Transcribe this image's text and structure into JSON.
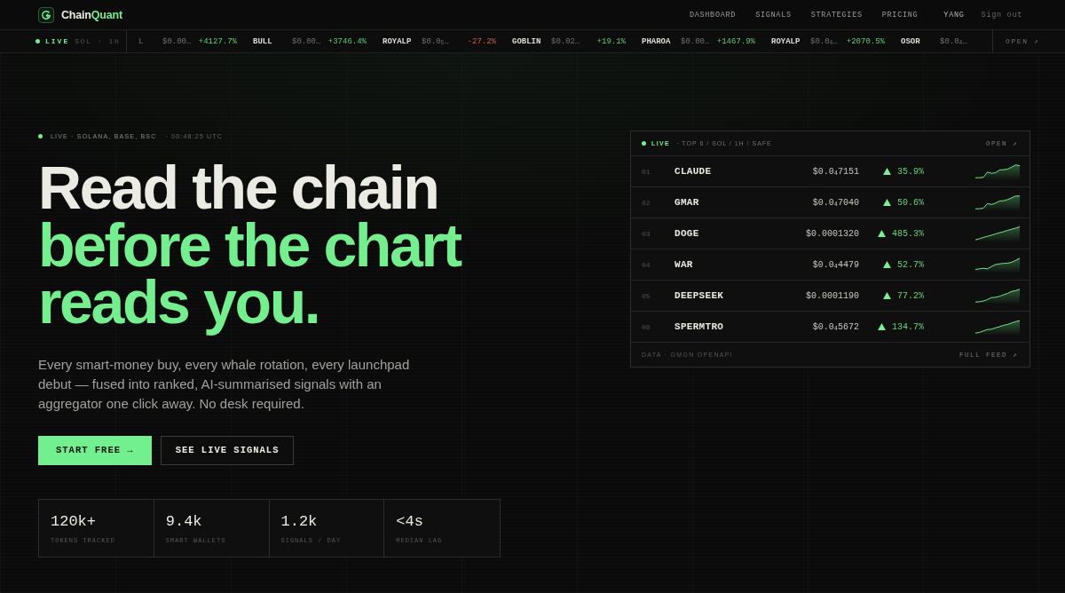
{
  "nav": {
    "brand": [
      "Chain",
      "Quant"
    ],
    "links": [
      "DASHBOARD",
      "SIGNALS",
      "STRATEGIES",
      "PRICING"
    ],
    "user": "YANG",
    "sign_out": "Sign out"
  },
  "ticker": {
    "status": "LIVE",
    "scope": "SOL · 1H",
    "items": [
      {
        "symbol": "L",
        "price": "$0.00…",
        "change": "+4127.7%",
        "down": false
      },
      {
        "symbol": "BULL",
        "price": "$0.00…",
        "change": "+3746.4%",
        "down": false
      },
      {
        "symbol": "ROYALP",
        "price": "$0.0$_{5}$…",
        "change": "-27.2%",
        "down": true
      },
      {
        "symbol": "GOBLIN",
        "price": "$0.02…",
        "change": "+19.1%",
        "down": false
      },
      {
        "symbol": "PHAROA",
        "price": "$0.00…",
        "change": "+1467.9%",
        "down": false
      },
      {
        "symbol": "ROYALP",
        "price": "$0.0$_{4}$…",
        "change": "+2070.5%",
        "down": false
      },
      {
        "symbol": "OSOR",
        "price": "$0.0$_{4}$…"
      }
    ],
    "action": "OPEN ↗"
  },
  "hero": {
    "status": {
      "label": "LIVE · SOLANA, BASE, BSC",
      "time": "· 00:48:25 UTC"
    },
    "headline": [
      {
        "text": "Read the chain",
        "accent": false
      },
      {
        "text": "before the chart",
        "accent": true
      },
      {
        "text": "reads you.",
        "accent": true
      }
    ],
    "description": "Every smart-money buy, every whale rotation, every launchpad debut — fused into ranked, AI-summarised signals with an aggregator one click away. No desk required.",
    "buttons": [
      {
        "label": "START FREE →",
        "kind": "primary"
      },
      {
        "label": "SEE LIVE SIGNALS",
        "kind": "secondary"
      }
    ],
    "stats": [
      {
        "value": "120k+",
        "label": "TOKENS TRACKED"
      },
      {
        "value": "9.4k",
        "label": "SMART WALLETS"
      },
      {
        "value": "1.2k",
        "label": "SIGNALS / DAY"
      },
      {
        "value": "<4s",
        "label": "MEDIAN LAG"
      }
    ]
  },
  "panel": {
    "status": "LIVE",
    "filter": "· TOP 6 / SOL / 1H / SAFE",
    "action": "OPEN ↗",
    "rows": [
      {
        "rank": "01",
        "name": "CLAUDE",
        "price": "$0.0$_{4}$7151",
        "down": false,
        "change": "35.9%"
      },
      {
        "rank": "02",
        "name": "GMAR",
        "price": "$0.0$_{4}$7040",
        "down": false,
        "change": "50.6%"
      },
      {
        "rank": "03",
        "name": "DOGE",
        "price": "$0.0001320",
        "down": false,
        "change": "485.3%"
      },
      {
        "rank": "04",
        "name": "WAR",
        "price": "$0.0$_{4}$4479",
        "down": false,
        "change": "52.7%"
      },
      {
        "rank": "05",
        "name": "DEEPSEEK",
        "price": "$0.0001190",
        "down": false,
        "change": "77.2%"
      },
      {
        "rank": "06",
        "name": "SPERMTRO",
        "price": "$0.0$_{4}$5672",
        "down": false,
        "change": "134.7%"
      }
    ],
    "footer": {
      "source": "DATA · GMGN OPENAPI",
      "action": "FULL FEED ↗"
    }
  }
}
